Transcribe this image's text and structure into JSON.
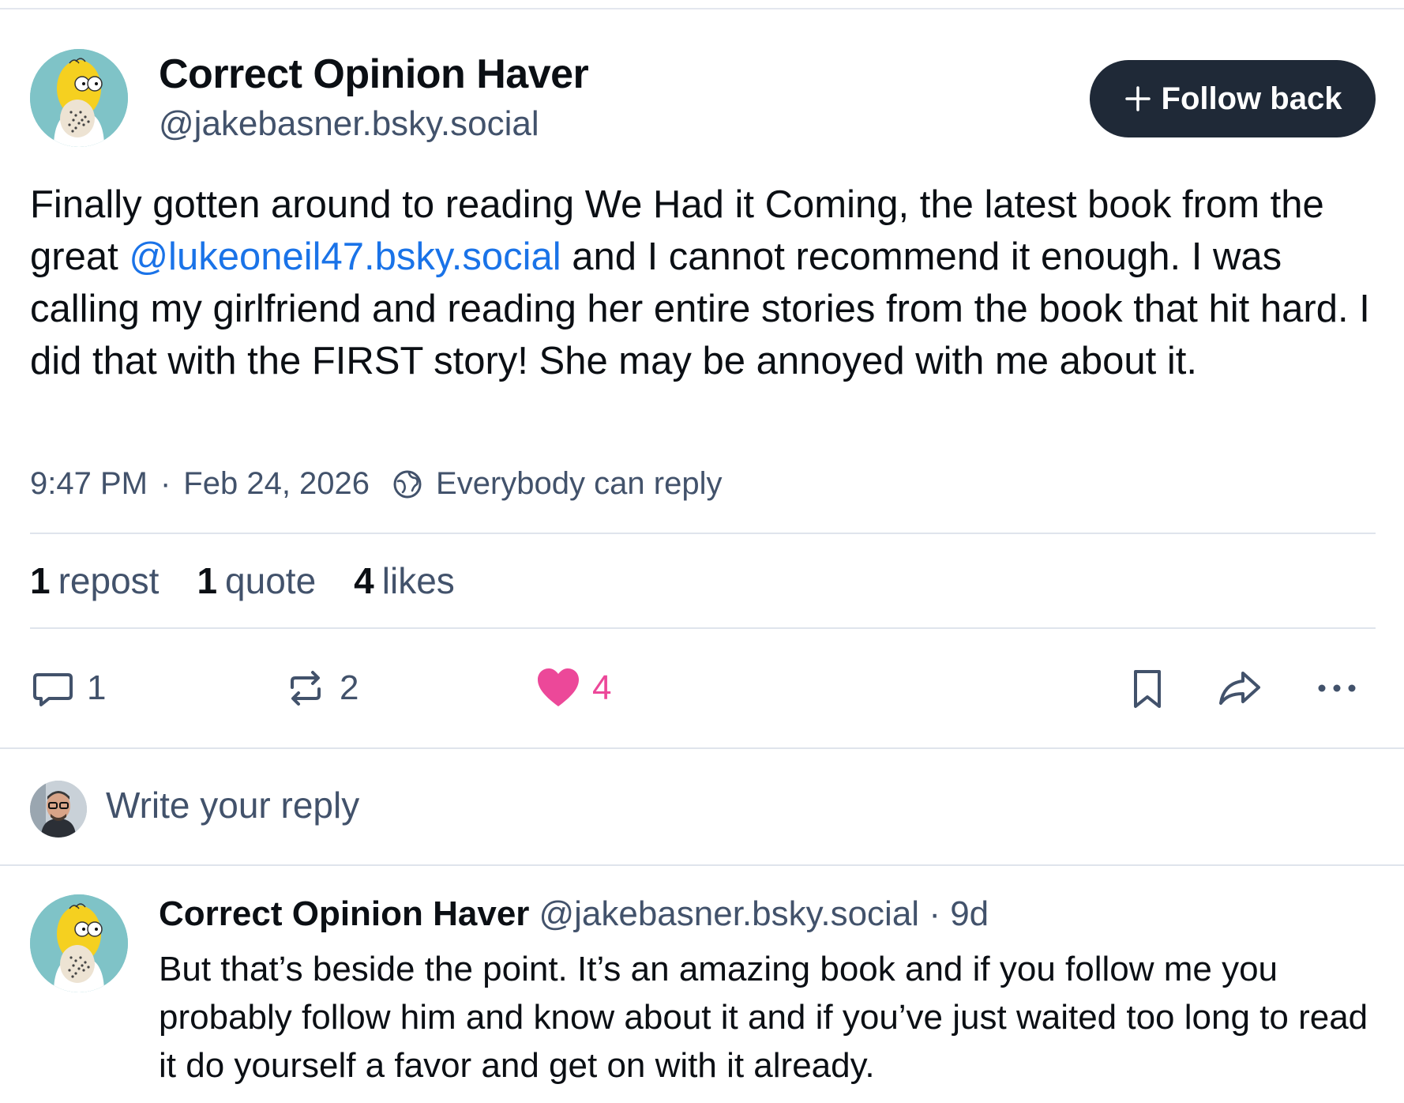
{
  "post": {
    "author_name": "Correct Opinion Haver",
    "author_handle": "@jakebasner.bsky.social",
    "follow_label": "Follow back",
    "text_before_mention": "Finally gotten around to reading We Had it Coming, the latest book from the great ",
    "mention": "@lukeoneil47.bsky.social",
    "text_after_mention": " and I cannot recommend it enough. I was calling my girlfriend and reading her entire stories from the book that hit hard. I did that with the FIRST story! She may be annoyed with me about it.",
    "time": "9:47 PM",
    "separator": "·",
    "date": "Feb 24, 2026",
    "reply_setting": "Everybody can reply"
  },
  "stats": {
    "reposts_count": "1",
    "reposts_label": "repost",
    "quotes_count": "1",
    "quotes_label": "quote",
    "likes_count": "4",
    "likes_label": "likes"
  },
  "actions": {
    "reply_count": "1",
    "repost_count": "2",
    "like_count": "4"
  },
  "compose": {
    "placeholder": "Write your reply"
  },
  "reply": {
    "author_name": "Correct Opinion Haver",
    "author_handle": "@jakebasner.bsky.social",
    "age": "· 9d",
    "text": "But that’s beside the point. It’s an amazing book and if you follow me you probably follow him and know about it and if you’ve just waited too long to read it do yourself a favor and get on with it already."
  },
  "colors": {
    "accent": "#1a73e8",
    "like": "#ec4899",
    "button_bg": "#1f2937",
    "muted": "#42526b"
  },
  "icons": [
    "plus-icon",
    "globe-icon",
    "reply-icon",
    "repost-icon",
    "heart-icon",
    "bookmark-icon",
    "share-icon",
    "more-icon"
  ]
}
